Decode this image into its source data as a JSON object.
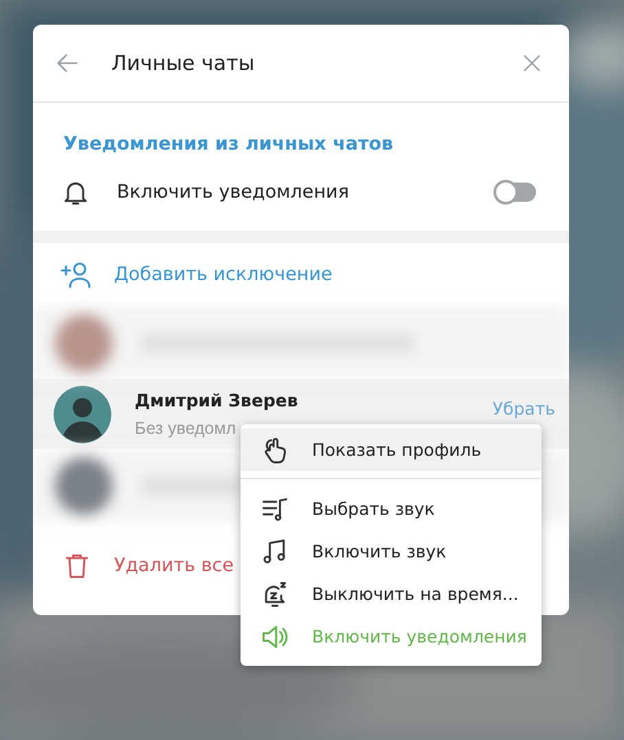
{
  "dialog": {
    "title": "Личные чаты",
    "section_title": "Уведомления из личных чатов",
    "toggle": {
      "label": "Включить уведомления",
      "on": false
    },
    "add_exception": "Добавить исключение",
    "exceptions": [
      {
        "kind": "blurred"
      },
      {
        "kind": "contact",
        "name": "Дмитрий Зверев",
        "status": "Без уведомл",
        "action": "Убрать",
        "selected": true
      },
      {
        "kind": "blurred"
      }
    ],
    "delete_all": "Удалить все"
  },
  "context_menu": {
    "items": [
      {
        "kind": "item",
        "label": "Показать профиль",
        "selected": true
      },
      {
        "kind": "separator"
      },
      {
        "kind": "item",
        "label": "Выбрать звук",
        "selected": false
      },
      {
        "kind": "item",
        "label": "Включить звук",
        "selected": false
      },
      {
        "kind": "item",
        "label": "Выключить на время...",
        "selected": false
      },
      {
        "kind": "accent",
        "label": "Включить уведомления",
        "selected": false
      }
    ]
  }
}
